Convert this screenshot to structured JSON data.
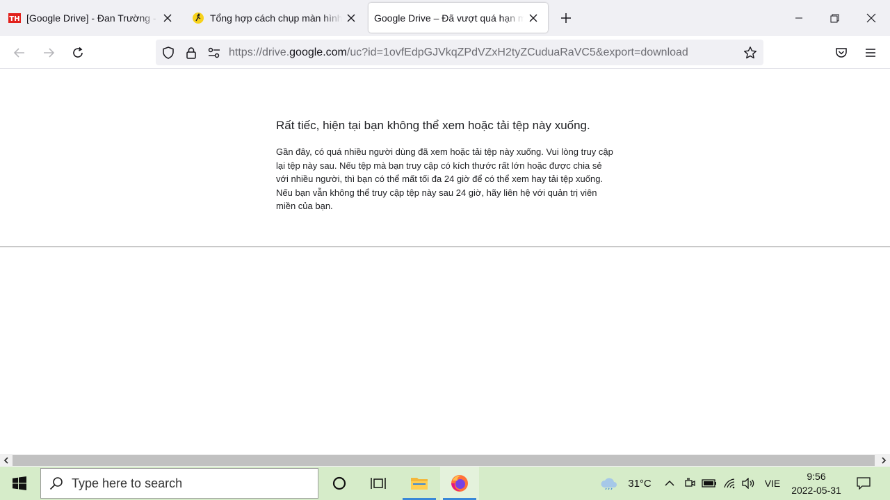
{
  "tabs": [
    {
      "title": "[Google Drive] - Đan Trường - Đ",
      "favicon": "th-favicon",
      "active": false
    },
    {
      "title": "Tổng hợp cách chụp màn hình l",
      "favicon": "emoji-runner-favicon",
      "active": false
    },
    {
      "title": "Google Drive – Đã vượt quá hạn mức",
      "favicon": "none",
      "active": true
    }
  ],
  "address_bar": {
    "url_prefix": "https://drive.",
    "url_host": "google.com",
    "url_rest": "/uc?id=1ovfEdpGJVkqZPdVZxH2tyZCuduaRaVC5&export=download"
  },
  "page": {
    "heading": "Rất tiếc, hiện tại bạn không thể xem hoặc tải tệp này xuống.",
    "message": "Gần đây, có quá nhiều người dùng đã xem hoặc tải tệp này xuống. Vui lòng truy cập lại tệp này sau. Nếu tệp mà bạn truy cập có kích thước rất lớn hoặc được chia sẻ với nhiều người, thì bạn có thể mất tối đa 24 giờ để có thể xem hay tải tệp xuống. Nếu bạn vẫn không thể truy cập tệp này sau 24 giờ, hãy liên hệ với quản trị viên miền của bạn."
  },
  "taskbar": {
    "search_placeholder": "Type here to search",
    "weather_temp": "31°C",
    "language": "VIE",
    "time": "9:56",
    "date": "2022-05-31"
  },
  "colors": {
    "tabstrip_bg": "#f0f0f4",
    "taskbar_bg": "#d6ecc9",
    "firefox_orange": "#ff7139"
  }
}
